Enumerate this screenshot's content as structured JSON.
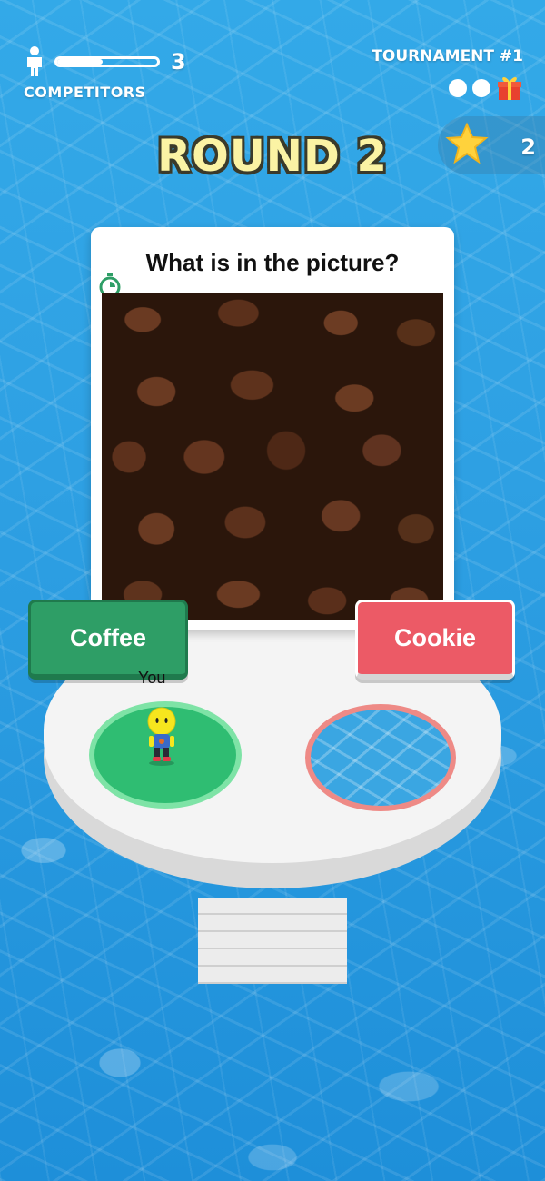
{
  "hud": {
    "competitors_count": "3",
    "competitors_label": "COMPETITORS",
    "competitors_progress": 0.45,
    "tournament_label": "TOURNAMENT #1",
    "tournament_dots": 2,
    "stars_count": "2"
  },
  "round": {
    "title": "ROUND 2"
  },
  "question": {
    "text": "What is in the picture?",
    "image": "coffee-beans-photo"
  },
  "answers": {
    "left": "Coffee",
    "right": "Cookie"
  },
  "player": {
    "label": "You",
    "zone": "left"
  },
  "colors": {
    "correct_green": "#2e9e66",
    "wrong_red": "#ec5a66",
    "round_title": "#fbf3a4",
    "water": "#2ea0e3"
  }
}
